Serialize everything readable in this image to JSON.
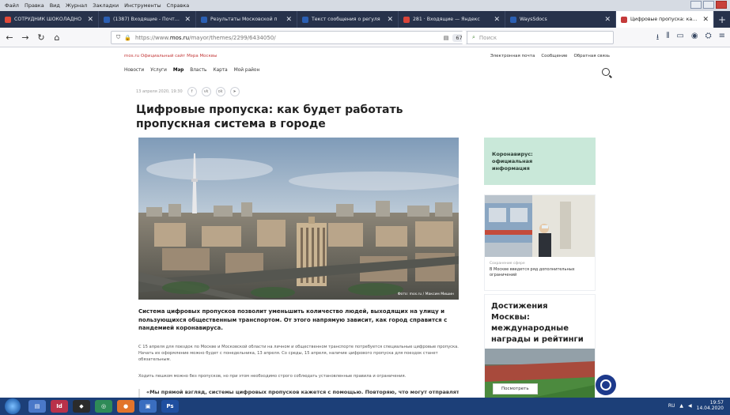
{
  "browser": {
    "menu": [
      "Файл",
      "Правка",
      "Вид",
      "Журнал",
      "Закладки",
      "Инструменты",
      "Справка"
    ],
    "tabs": [
      {
        "label": "СОТРУДНИК ШОКОЛАДНО",
        "color": "#e14a3a",
        "active": false
      },
      {
        "label": "(1387) Входящие - Почта М",
        "color": "#2b5fb3",
        "active": false
      },
      {
        "label": "Результаты Московской п",
        "color": "#2b5fb3",
        "active": false
      },
      {
        "label": "Текст сообщения о регуля",
        "color": "#2b5fb3",
        "active": false
      },
      {
        "label": "281 · Входящие — Яндекс",
        "color": "#d9443a",
        "active": false
      },
      {
        "label": "WaysSdocs",
        "color": "#2b5fb3",
        "active": false
      },
      {
        "label": "Цифровые пропуска: как б",
        "color": "#c43a3a",
        "active": true
      }
    ],
    "url_prefix": "https://www.",
    "url_domain": "mos.ru",
    "url_path": "/mayor/themes/2299/6434050/",
    "zoom": "67%",
    "search_placeholder": "Поиск"
  },
  "site": {
    "top_label": "mos.ru  Официальный сайт Мэра Москвы",
    "top_links": [
      "Электронная почта",
      "Сообщение",
      "Обратная связь"
    ],
    "nav": [
      "Новости",
      "Услуги",
      "Мэр",
      "Власть",
      "Карта",
      "Мой район"
    ],
    "nav_active": "Мэр"
  },
  "article": {
    "date": "13 апреля 2020, 19:30",
    "title": "Цифровые пропуска: как будет работать пропускная система в городе",
    "photo_credit": "Фото: mos.ru / Максим Мишин",
    "lead": "Система цифровых пропусков позволит уменьшить количество людей, выходящих на улицу и пользующихся общественным транспортом. От этого напрямую зависит, как город справится с пандемией коронавируса.",
    "body1": "С 15 апреля для поездок по Москве и Московской области на личном и общественном транспорте потребуется специальные цифровые пропуска. Начать их оформление можно будет с понедельника, 13 апреля. Со среды, 15 апреля, наличие цифрового пропуска для поездок станет обязательным.",
    "body2": "Ходить пешком можно без пропусков, но при этом необходимо строго соблюдать установленные правила и ограничения.",
    "quote": "«Мы прямой взгляд, системы цифровых пропусков кажется с помощью. Повторяю, что могут отправлять"
  },
  "sidebar": {
    "covid_card": "Коронавирус: официальная информация",
    "news_tag": "Сохранение сфере",
    "news_text": "В Москве введется ряд дополнительных ограничений",
    "achievements_title": "Достижения Москвы: международные награды и рейтинги",
    "achievements_button": "Посмотреть"
  },
  "taskbar": {
    "tray_lang": "RU",
    "time": "19:57",
    "date": "14.04.2020"
  }
}
